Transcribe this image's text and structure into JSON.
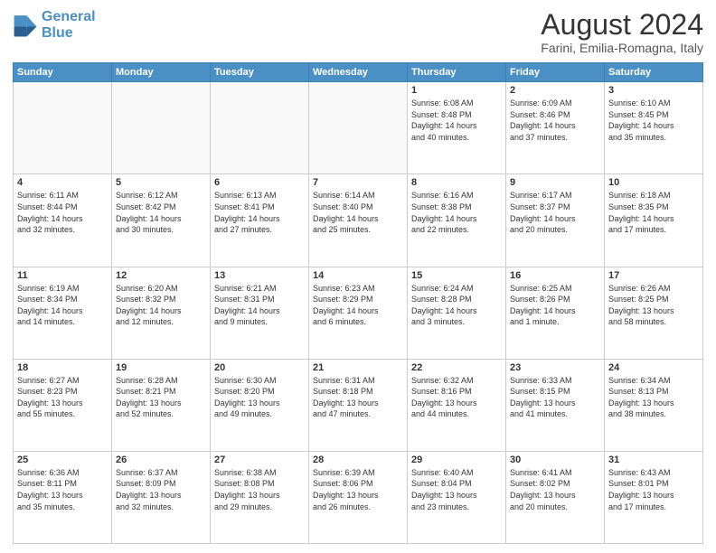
{
  "header": {
    "logo_line1": "General",
    "logo_line2": "Blue",
    "main_title": "August 2024",
    "subtitle": "Farini, Emilia-Romagna, Italy"
  },
  "days_of_week": [
    "Sunday",
    "Monday",
    "Tuesday",
    "Wednesday",
    "Thursday",
    "Friday",
    "Saturday"
  ],
  "weeks": [
    [
      {
        "day": "",
        "info": ""
      },
      {
        "day": "",
        "info": ""
      },
      {
        "day": "",
        "info": ""
      },
      {
        "day": "",
        "info": ""
      },
      {
        "day": "1",
        "info": "Sunrise: 6:08 AM\nSunset: 8:48 PM\nDaylight: 14 hours\nand 40 minutes."
      },
      {
        "day": "2",
        "info": "Sunrise: 6:09 AM\nSunset: 8:46 PM\nDaylight: 14 hours\nand 37 minutes."
      },
      {
        "day": "3",
        "info": "Sunrise: 6:10 AM\nSunset: 8:45 PM\nDaylight: 14 hours\nand 35 minutes."
      }
    ],
    [
      {
        "day": "4",
        "info": "Sunrise: 6:11 AM\nSunset: 8:44 PM\nDaylight: 14 hours\nand 32 minutes."
      },
      {
        "day": "5",
        "info": "Sunrise: 6:12 AM\nSunset: 8:42 PM\nDaylight: 14 hours\nand 30 minutes."
      },
      {
        "day": "6",
        "info": "Sunrise: 6:13 AM\nSunset: 8:41 PM\nDaylight: 14 hours\nand 27 minutes."
      },
      {
        "day": "7",
        "info": "Sunrise: 6:14 AM\nSunset: 8:40 PM\nDaylight: 14 hours\nand 25 minutes."
      },
      {
        "day": "8",
        "info": "Sunrise: 6:16 AM\nSunset: 8:38 PM\nDaylight: 14 hours\nand 22 minutes."
      },
      {
        "day": "9",
        "info": "Sunrise: 6:17 AM\nSunset: 8:37 PM\nDaylight: 14 hours\nand 20 minutes."
      },
      {
        "day": "10",
        "info": "Sunrise: 6:18 AM\nSunset: 8:35 PM\nDaylight: 14 hours\nand 17 minutes."
      }
    ],
    [
      {
        "day": "11",
        "info": "Sunrise: 6:19 AM\nSunset: 8:34 PM\nDaylight: 14 hours\nand 14 minutes."
      },
      {
        "day": "12",
        "info": "Sunrise: 6:20 AM\nSunset: 8:32 PM\nDaylight: 14 hours\nand 12 minutes."
      },
      {
        "day": "13",
        "info": "Sunrise: 6:21 AM\nSunset: 8:31 PM\nDaylight: 14 hours\nand 9 minutes."
      },
      {
        "day": "14",
        "info": "Sunrise: 6:23 AM\nSunset: 8:29 PM\nDaylight: 14 hours\nand 6 minutes."
      },
      {
        "day": "15",
        "info": "Sunrise: 6:24 AM\nSunset: 8:28 PM\nDaylight: 14 hours\nand 3 minutes."
      },
      {
        "day": "16",
        "info": "Sunrise: 6:25 AM\nSunset: 8:26 PM\nDaylight: 14 hours\nand 1 minute."
      },
      {
        "day": "17",
        "info": "Sunrise: 6:26 AM\nSunset: 8:25 PM\nDaylight: 13 hours\nand 58 minutes."
      }
    ],
    [
      {
        "day": "18",
        "info": "Sunrise: 6:27 AM\nSunset: 8:23 PM\nDaylight: 13 hours\nand 55 minutes."
      },
      {
        "day": "19",
        "info": "Sunrise: 6:28 AM\nSunset: 8:21 PM\nDaylight: 13 hours\nand 52 minutes."
      },
      {
        "day": "20",
        "info": "Sunrise: 6:30 AM\nSunset: 8:20 PM\nDaylight: 13 hours\nand 49 minutes."
      },
      {
        "day": "21",
        "info": "Sunrise: 6:31 AM\nSunset: 8:18 PM\nDaylight: 13 hours\nand 47 minutes."
      },
      {
        "day": "22",
        "info": "Sunrise: 6:32 AM\nSunset: 8:16 PM\nDaylight: 13 hours\nand 44 minutes."
      },
      {
        "day": "23",
        "info": "Sunrise: 6:33 AM\nSunset: 8:15 PM\nDaylight: 13 hours\nand 41 minutes."
      },
      {
        "day": "24",
        "info": "Sunrise: 6:34 AM\nSunset: 8:13 PM\nDaylight: 13 hours\nand 38 minutes."
      }
    ],
    [
      {
        "day": "25",
        "info": "Sunrise: 6:36 AM\nSunset: 8:11 PM\nDaylight: 13 hours\nand 35 minutes."
      },
      {
        "day": "26",
        "info": "Sunrise: 6:37 AM\nSunset: 8:09 PM\nDaylight: 13 hours\nand 32 minutes."
      },
      {
        "day": "27",
        "info": "Sunrise: 6:38 AM\nSunset: 8:08 PM\nDaylight: 13 hours\nand 29 minutes."
      },
      {
        "day": "28",
        "info": "Sunrise: 6:39 AM\nSunset: 8:06 PM\nDaylight: 13 hours\nand 26 minutes."
      },
      {
        "day": "29",
        "info": "Sunrise: 6:40 AM\nSunset: 8:04 PM\nDaylight: 13 hours\nand 23 minutes."
      },
      {
        "day": "30",
        "info": "Sunrise: 6:41 AM\nSunset: 8:02 PM\nDaylight: 13 hours\nand 20 minutes."
      },
      {
        "day": "31",
        "info": "Sunrise: 6:43 AM\nSunset: 8:01 PM\nDaylight: 13 hours\nand 17 minutes."
      }
    ]
  ]
}
